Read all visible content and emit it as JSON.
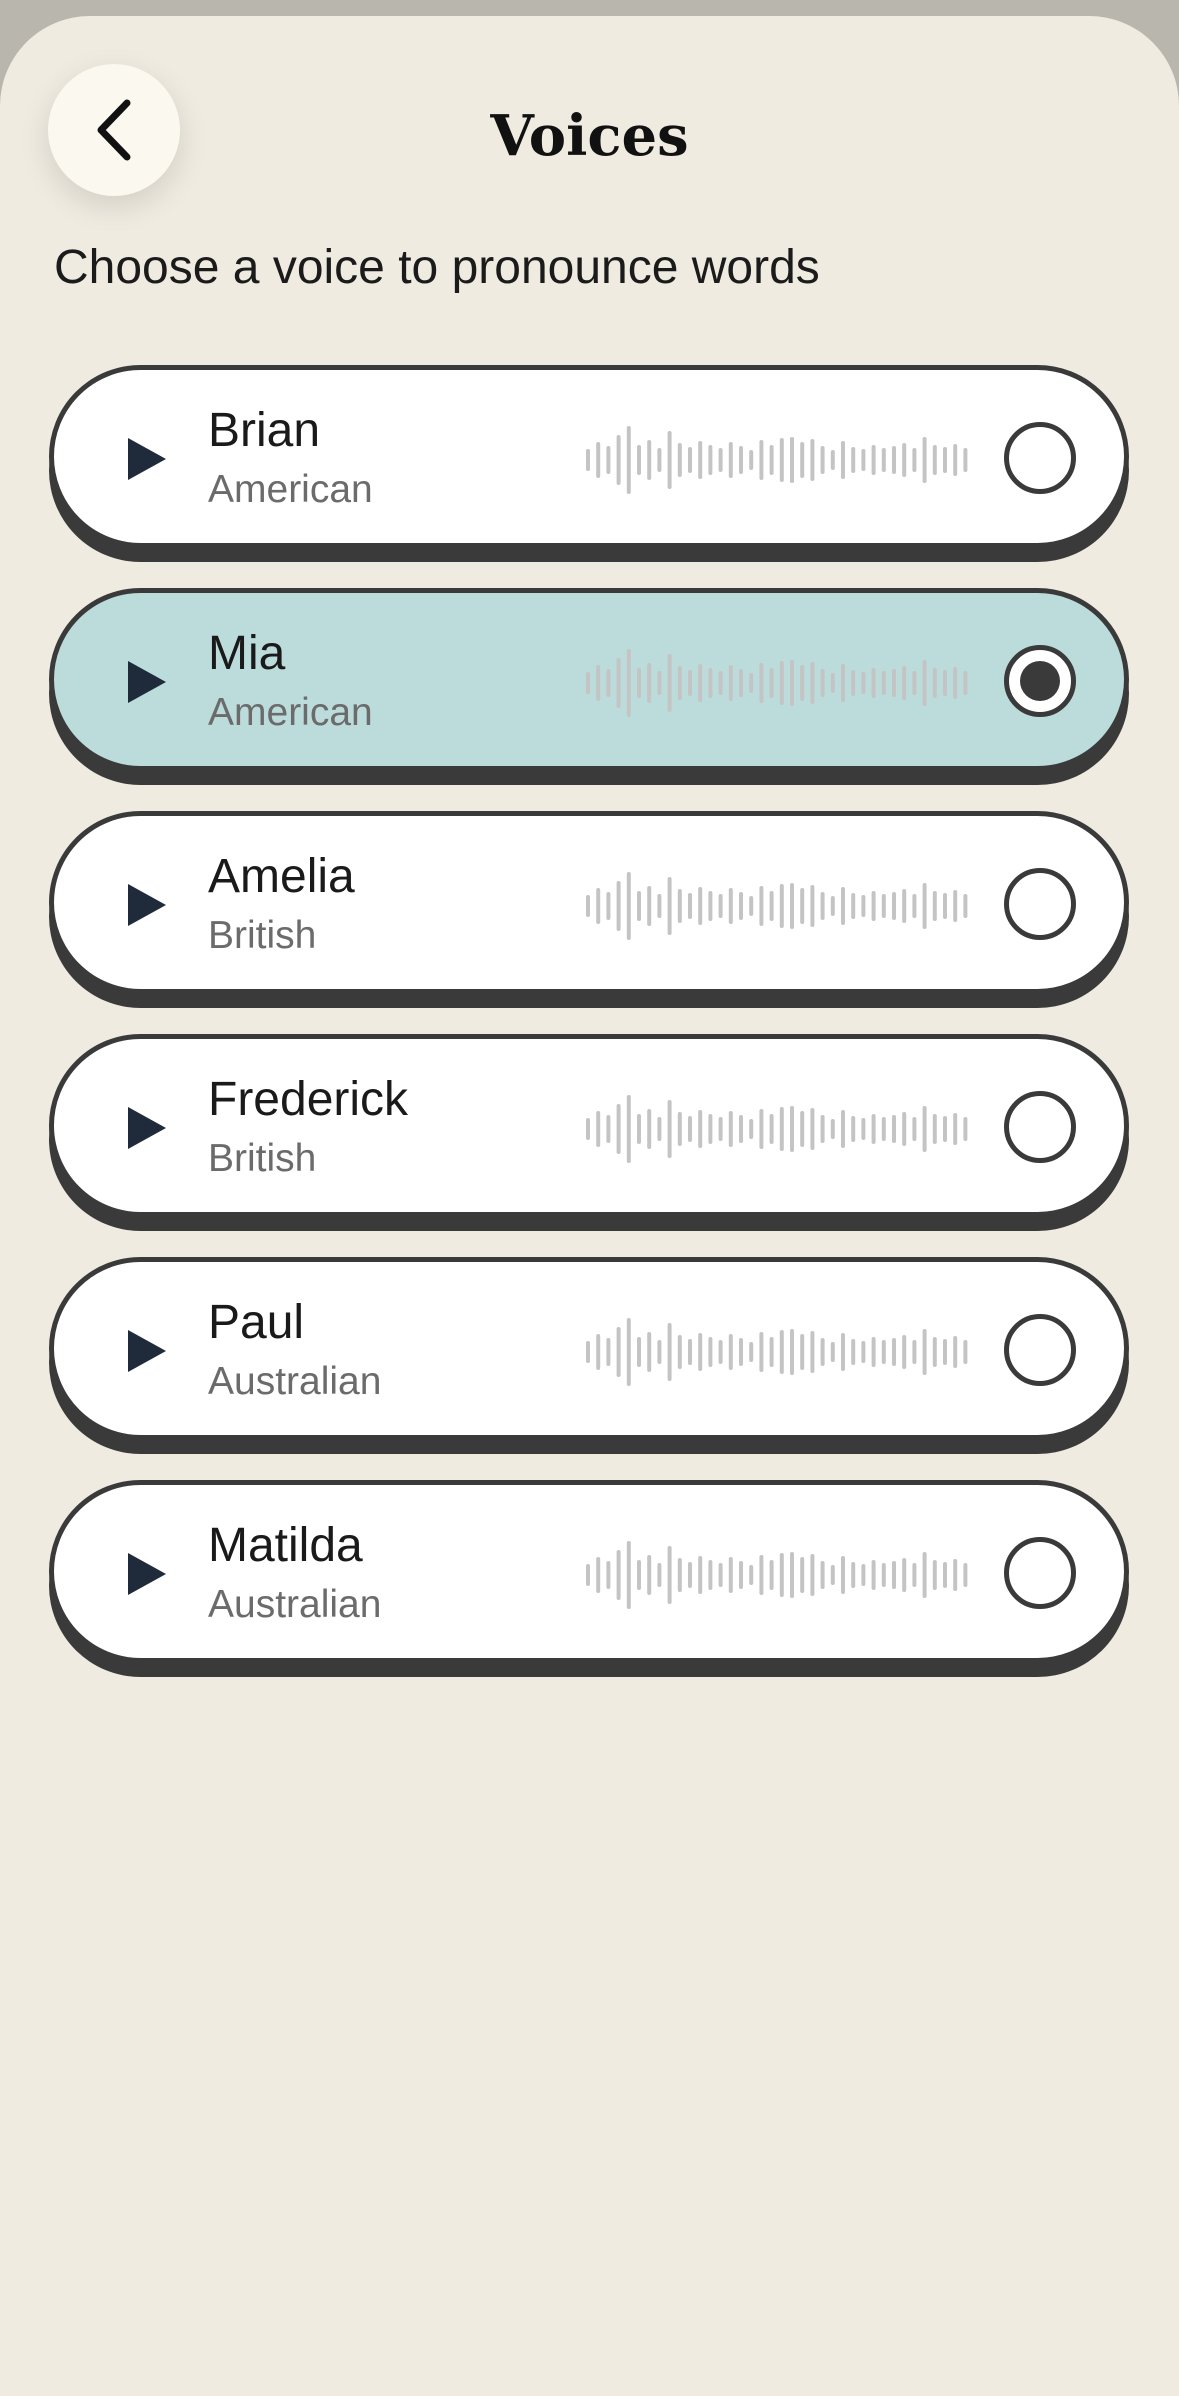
{
  "header": {
    "title": "Voices",
    "back_icon": "chevron-left-icon"
  },
  "subtitle": "Choose a voice to pronounce words",
  "colors": {
    "background": "#efebe1",
    "card": "#ffffff",
    "card_selected": "#bcdcdc",
    "border": "#3a3a3a",
    "play_icon": "#1f2a3a",
    "waveform": "#c4c4c4"
  },
  "voices": [
    {
      "name": "Brian",
      "accent": "American",
      "selected": false
    },
    {
      "name": "Mia",
      "accent": "American",
      "selected": true
    },
    {
      "name": "Amelia",
      "accent": "British",
      "selected": false
    },
    {
      "name": "Frederick",
      "accent": "British",
      "selected": false
    },
    {
      "name": "Paul",
      "accent": "Australian",
      "selected": false
    },
    {
      "name": "Matilda",
      "accent": "Australian",
      "selected": false
    }
  ]
}
